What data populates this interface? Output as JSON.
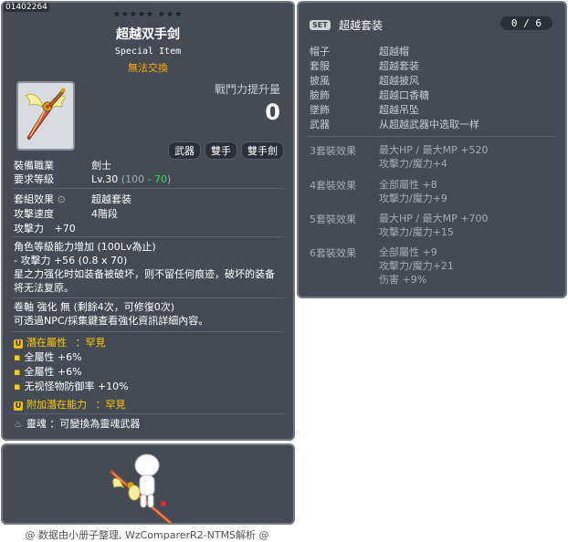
{
  "item": {
    "id": "01402264",
    "stars": "★★★★★  ★★★",
    "name": "超越双手剑",
    "type": "Special Item",
    "trade": "無法交換",
    "power_label": "戰鬥力提升量",
    "power_value": "0",
    "tags": [
      "武器",
      "雙手",
      "雙手劍"
    ],
    "stats": {
      "job_key": "裝備職業",
      "job_val": "劍士",
      "level_key": "要求等級",
      "level_val": "Lv.30",
      "level_detail_pre": "(100 ",
      "level_detail_mod": "- 70",
      "level_detail_post": ")",
      "set_key": "套組效果",
      "set_val": "超越套装",
      "speed_key": "攻擊速度",
      "speed_val": "4階段",
      "attack_key": "攻擊力",
      "attack_val": "+70"
    },
    "growth_title": "角色等級能力增加 (100Lv為止)",
    "growth_line": "- 攻擊力 +56 (0.8 x 70)",
    "growth_desc": "星之力强化时如装备被破坏，则不留任何痕迹，破坏的装备将无法复原。",
    "scroll_line": "卷軸 強化 無 (剩餘4次，可修復0次)",
    "npc_line": "可透過NPC/採集鍵查看強化資訊詳細內容。",
    "potential_label": "潛在屬性",
    "potential_grade": "：罕見",
    "potential_lines": [
      "全屬性 +6%",
      "全屬性 +6%",
      "无视怪物防御率 +10%"
    ],
    "additional_label": "附加潛在能力",
    "additional_grade": "：罕見",
    "soul_line": "靈魂 ：可變換為靈魂武器"
  },
  "set": {
    "badge": "SET",
    "name": "超越套装",
    "count": "0 / 6",
    "pieces": [
      {
        "slot": "帽子",
        "name": "超越帽"
      },
      {
        "slot": "套服",
        "name": "超越套装"
      },
      {
        "slot": "披風",
        "name": "超越披风"
      },
      {
        "slot": "臉飾",
        "name": "超越口香糖"
      },
      {
        "slot": "墜飾",
        "name": "超越吊坠"
      },
      {
        "slot": "武器",
        "name": "从超越武器中选取一样"
      }
    ],
    "bonuses": [
      {
        "label": "3套裝效果",
        "lines": [
          "最大HP / 最大MP  +520",
          "攻擊力/魔力+4"
        ]
      },
      {
        "label": "4套裝效果",
        "lines": [
          "全部屬性 +8",
          "攻擊力/魔力+9"
        ]
      },
      {
        "label": "5套裝效果",
        "lines": [
          "最大HP / 最大MP  +700",
          "攻擊力/魔力+15"
        ]
      },
      {
        "label": "6套裝效果",
        "lines": [
          "全部屬性 +9",
          "攻擊力/魔力+21",
          "伤害 +9%"
        ]
      }
    ]
  },
  "footer": "@ 数据由小册子整理, WzComparerR2-NTMS解析 @"
}
